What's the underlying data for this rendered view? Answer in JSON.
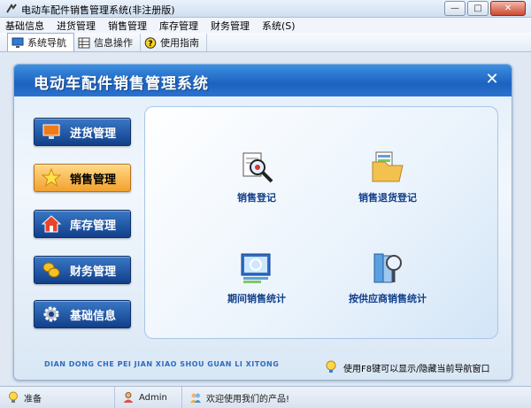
{
  "window": {
    "title": "电动车配件销售管理系统(非注册版)",
    "minimize_glyph": "—",
    "maximize_glyph": "□",
    "close_glyph": "✕"
  },
  "menu": {
    "items": [
      {
        "label": "基础信息"
      },
      {
        "label": "进货管理"
      },
      {
        "label": "销售管理"
      },
      {
        "label": "库存管理"
      },
      {
        "label": "财务管理"
      },
      {
        "label": "系统(S)"
      }
    ]
  },
  "toolbar": {
    "tabs": [
      {
        "label": "系统导航",
        "icon": "monitor-icon"
      },
      {
        "label": "信息操作",
        "icon": "grid-icon"
      },
      {
        "label": "使用指南",
        "icon": "help-icon"
      }
    ]
  },
  "panel": {
    "title": "电动车配件销售管理系统",
    "close_glyph": "✕",
    "pinyin": "DIAN DONG CHE PEI JIAN XIAO SHOU GUAN LI XITONG",
    "hint": "使用F8键可以显示/隐藏当前导航窗口"
  },
  "sidebar": {
    "items": [
      {
        "label": "进货管理",
        "icon": "monitor-icon"
      },
      {
        "label": "销售管理",
        "icon": "star-icon"
      },
      {
        "label": "库存管理",
        "icon": "house-icon"
      },
      {
        "label": "财务管理",
        "icon": "coins-icon"
      },
      {
        "label": "基础信息",
        "icon": "gear-icon"
      }
    ],
    "active_index": 1
  },
  "features": [
    {
      "label": "销售登记",
      "icon": "magnifier-document-icon"
    },
    {
      "label": "销售退货登记",
      "icon": "folder-document-icon"
    },
    {
      "label": "期间销售统计",
      "icon": "chart-magnifier-icon"
    },
    {
      "label": "按供应商销售统计",
      "icon": "binder-magnifier-icon"
    }
  ],
  "status": {
    "state": "准备",
    "user": "Admin",
    "message": "欢迎使用我们的产品!"
  },
  "colors": {
    "header_blue": "#1c62c0",
    "nav_blue": "#123f8a",
    "nav_active": "#f2a12c",
    "label_blue": "#123f8a"
  }
}
